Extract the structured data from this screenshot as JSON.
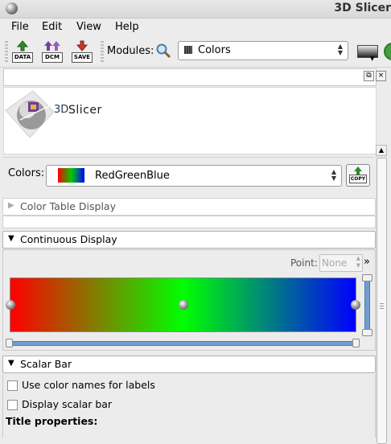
{
  "window": {
    "title": "3D Slicer"
  },
  "menubar": {
    "items": [
      "File",
      "Edit",
      "View",
      "Help"
    ]
  },
  "toolbar": {
    "data_label": "DATA",
    "dcm_label": "DCM",
    "save_label": "SAVE",
    "modules_label": "Modules:",
    "module_selected": "Colors"
  },
  "logo": {
    "text_3d": "3D",
    "text_slicer": "Slicer"
  },
  "colors_row": {
    "label": "Colors:",
    "selected": "RedGreenBlue",
    "copy_label": "COPY"
  },
  "sections": {
    "color_table_display": "Color Table Display",
    "continuous_display": "Continuous Display",
    "scalar_bar": "Scalar Bar"
  },
  "continuous": {
    "point_label": "Point:",
    "point_placeholder": "None",
    "more_glyph": "»",
    "gradient_colors": [
      "#ff0000",
      "#00ff00",
      "#0000ff"
    ],
    "control_point_positions": [
      0,
      0.5,
      1
    ]
  },
  "scalar_bar": {
    "use_color_names": "Use color names for labels",
    "display_scalar_bar": "Display scalar bar",
    "title_properties": "Title properties:"
  }
}
